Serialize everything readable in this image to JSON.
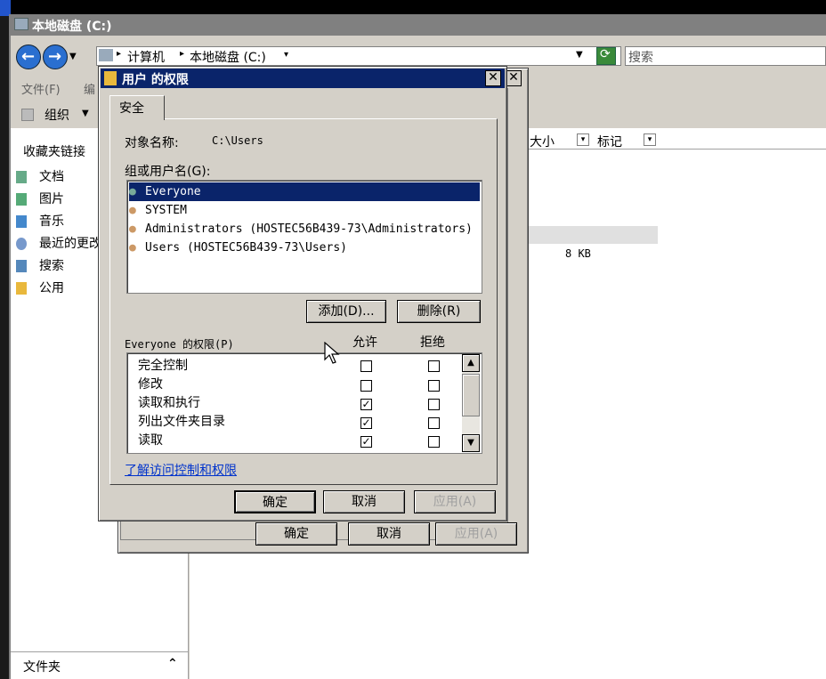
{
  "explorer": {
    "title": "本地磁盘 (C:)",
    "address": [
      "计算机",
      "本地磁盘 (C:)"
    ],
    "search_placeholder": "搜索",
    "menu": [
      "文件(F)",
      "编"
    ],
    "organize": "组织",
    "favorites_title": "收藏夹链接",
    "favorites": [
      "文档",
      "图片",
      "音乐",
      "最近的更改",
      "搜索",
      "公用"
    ],
    "folders_label": "文件夹",
    "columns": [
      "大小",
      "标记"
    ],
    "file_size": "8 KB"
  },
  "behind_dialog": {
    "ok": "确定",
    "cancel": "取消",
    "apply": "应用(A)"
  },
  "dialog": {
    "title": "用户 的权限",
    "tab": "安全",
    "object_label": "对象名称:",
    "object_value": "C:\\Users",
    "group_label": "组或用户名(G):",
    "users": [
      {
        "name": "Everyone",
        "selected": true
      },
      {
        "name": "SYSTEM",
        "selected": false
      },
      {
        "name": "Administrators (HOSTEC56B439-73\\Administrators)",
        "selected": false
      },
      {
        "name": "Users (HOSTEC56B439-73\\Users)",
        "selected": false
      }
    ],
    "add_button": "添加(D)...",
    "remove_button": "删除(R)",
    "perm_label": "Everyone 的权限(P)",
    "allow_header": "允许",
    "deny_header": "拒绝",
    "permissions": [
      {
        "name": "完全控制",
        "allow": false,
        "deny": false
      },
      {
        "name": "修改",
        "allow": false,
        "deny": false
      },
      {
        "name": "读取和执行",
        "allow": true,
        "deny": false
      },
      {
        "name": "列出文件夹目录",
        "allow": true,
        "deny": false
      },
      {
        "name": "读取",
        "allow": true,
        "deny": false
      }
    ],
    "link": "了解访问控制和权限",
    "ok": "确定",
    "cancel": "取消",
    "apply": "应用(A)"
  }
}
